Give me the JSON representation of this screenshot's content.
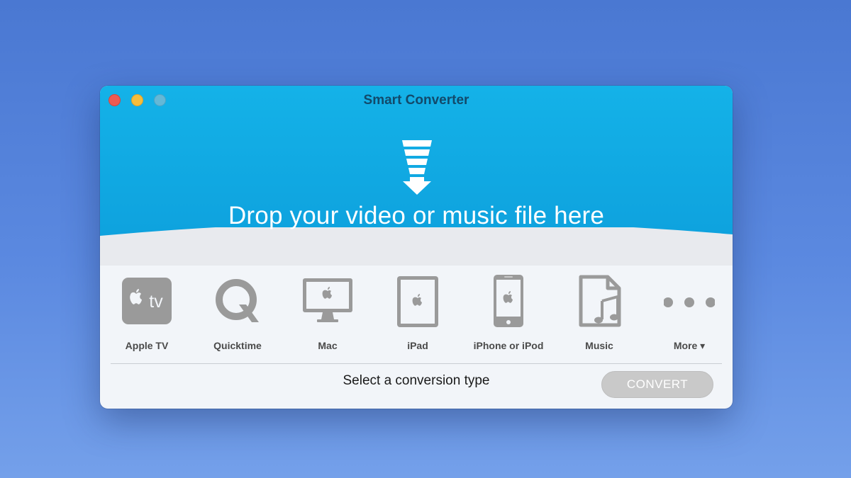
{
  "window": {
    "title": "Smart Converter"
  },
  "dropzone": {
    "text": "Drop your video or music file here",
    "icon": "drop-arrow-icon"
  },
  "devices": [
    {
      "label": "Apple TV",
      "icon": "apple-tv-icon",
      "badge": "tv"
    },
    {
      "label": "Quicktime",
      "icon": "quicktime-icon"
    },
    {
      "label": "Mac",
      "icon": "mac-monitor-icon"
    },
    {
      "label": "iPad",
      "icon": "ipad-icon"
    },
    {
      "label": "iPhone or iPod",
      "icon": "iphone-icon"
    },
    {
      "label": "Music",
      "icon": "music-file-icon"
    },
    {
      "label": "More ▾",
      "icon": "more-dots-icon"
    }
  ],
  "status": {
    "text": "Select a conversion type"
  },
  "convert_button": {
    "label": "CONVERT",
    "enabled": false
  },
  "colors": {
    "accent": "#0fa9e2",
    "title_text": "#124a6b",
    "icon_gray": "#9a9a9a",
    "button_disabled": "#c9c9c9"
  }
}
